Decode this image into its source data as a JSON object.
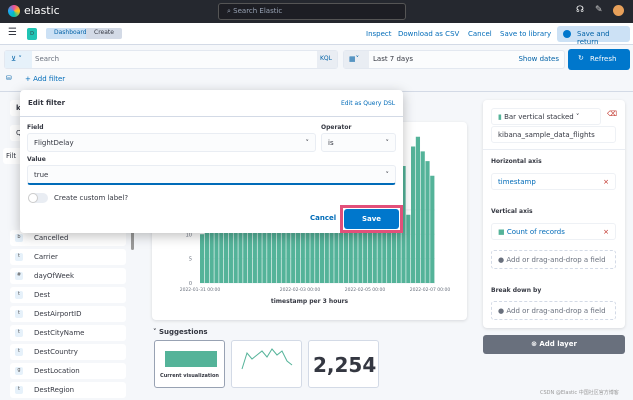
{
  "topbar": {
    "brand": "elastic",
    "search_placeholder": "Search Elastic"
  },
  "header": {
    "badge": "D",
    "breadcrumbs": [
      "Dashboard",
      "Create"
    ],
    "inspect": "Inspect",
    "download": "Download as CSV",
    "cancel": "Cancel",
    "save_library": "Save to library",
    "save_return": "Save and return"
  },
  "query": {
    "placeholder": "Search",
    "language": "KQL",
    "date_range": "Last 7 days",
    "show_dates": "Show dates",
    "refresh": "Refresh",
    "add_filter": "+ Add filter"
  },
  "sidebar": {
    "index": "kil",
    "search": "Q",
    "filter": "Filt",
    "fields": [
      "Cancelled",
      "Carrier",
      "dayOfWeek",
      "Dest",
      "DestAirportID",
      "DestCityName",
      "DestCountry",
      "DestLocation",
      "DestRegion"
    ],
    "field_types": [
      "b",
      "t",
      "#",
      "t",
      "t",
      "t",
      "t",
      "g",
      "t"
    ]
  },
  "popover": {
    "title": "Edit filter",
    "edit_dsl": "Edit as Query DSL",
    "field_label": "Field",
    "field_value": "FlightDelay",
    "operator_label": "Operator",
    "operator_value": "is",
    "value_label": "Value",
    "value": "true",
    "custom_label": "Create custom label?",
    "cancel": "Cancel",
    "save": "Save",
    "highlight_color": "#e2507a"
  },
  "chart_data": {
    "type": "bar",
    "xlabel": "timestamp per 3 hours",
    "ylabel": "",
    "y_ticks": [
      0,
      5,
      10,
      15
    ],
    "x_ticks": [
      "2022-01-31 00:00",
      "2022-02-03 00:00",
      "2022-02-05 00:00",
      "2022-02-07 00:00"
    ],
    "color": "#54b399",
    "values": [
      10,
      22,
      23,
      22,
      24,
      23,
      22,
      25,
      23,
      22,
      24,
      23,
      22,
      23,
      25,
      22,
      24,
      23,
      22,
      24,
      23,
      25,
      22,
      23,
      24,
      22,
      23,
      25,
      24,
      22,
      23,
      24,
      22,
      23,
      24,
      26,
      25,
      22,
      21,
      23,
      20,
      19,
      24,
      14,
      28,
      30,
      27,
      25,
      22
    ]
  },
  "suggestions": {
    "title": "Suggestions",
    "current": "Current visualization",
    "metric": "2,254"
  },
  "right": {
    "chart_type": "Bar vertical stacked",
    "index": "kibana_sample_data_flights",
    "h_axis": "Horizontal axis",
    "h_field": "timestamp",
    "v_axis": "Vertical axis",
    "v_field": "Count of records",
    "add_field": "Add or drag-and-drop a field",
    "breakdown": "Break down by",
    "add_layer": "Add layer"
  },
  "watermark": "CSDN @Elastic 中国社区官方博客"
}
